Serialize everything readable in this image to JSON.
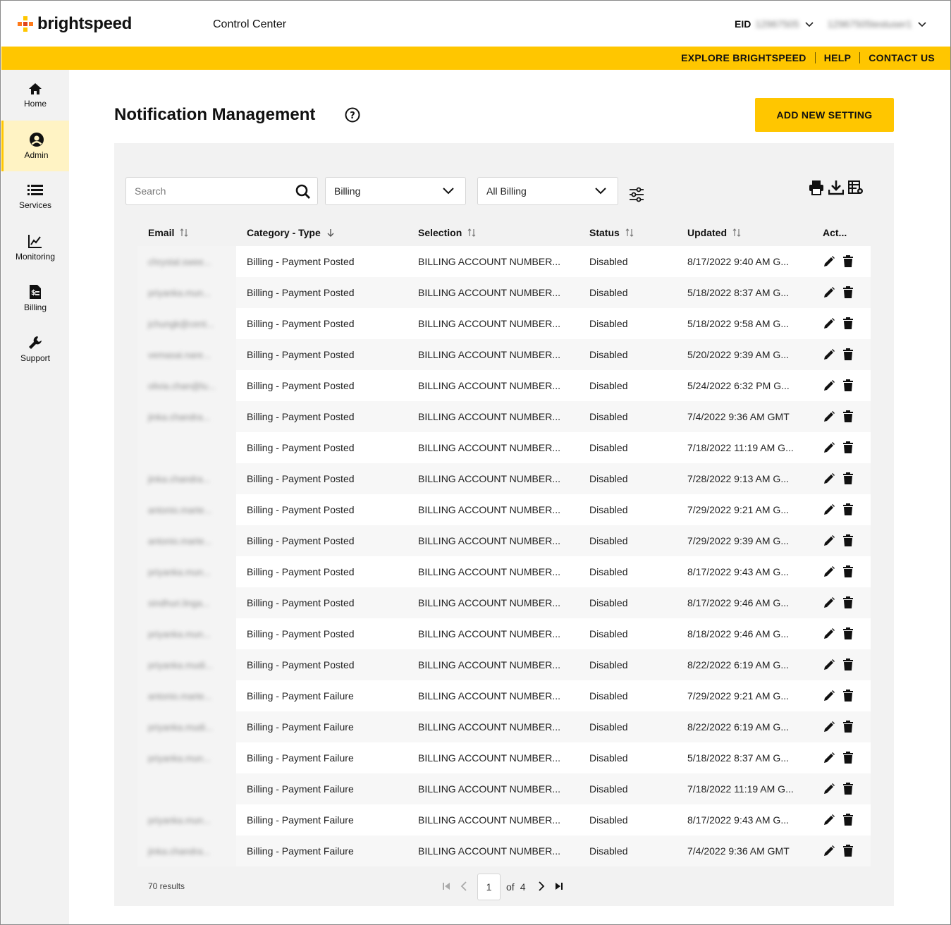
{
  "header": {
    "brand": "brightspeed",
    "app_title": "Control Center",
    "eid_label": "EID",
    "eid_value": "12967505",
    "user": "12967505testuser1"
  },
  "top_links": [
    "EXPLORE BRIGHTSPEED",
    "HELP",
    "CONTACT US"
  ],
  "sidebar": {
    "items": [
      {
        "label": "Home",
        "icon": "home-icon"
      },
      {
        "label": "Admin",
        "icon": "user-circle-icon",
        "active": true
      },
      {
        "label": "Services",
        "icon": "list-icon"
      },
      {
        "label": "Monitoring",
        "icon": "chart-line-icon"
      },
      {
        "label": "Billing",
        "icon": "invoice-icon"
      },
      {
        "label": "Support",
        "icon": "wrench-icon"
      }
    ]
  },
  "page": {
    "title": "Notification Management",
    "add_button": "ADD NEW SETTING"
  },
  "filters": {
    "search_placeholder": "Search",
    "category": "Billing",
    "type": "All Billing"
  },
  "columns": [
    "Email",
    "Category - Type",
    "Selection",
    "Status",
    "Updated",
    "Act..."
  ],
  "rows": [
    {
      "email": "chrystal.swee...",
      "cat": "Billing - Payment Posted",
      "sel": "BILLING ACCOUNT NUMBER...",
      "status": "Disabled",
      "updated": "8/17/2022 9:40 AM G..."
    },
    {
      "email": "priyanka.mun...",
      "cat": "Billing - Payment Posted",
      "sel": "BILLING ACCOUNT NUMBER...",
      "status": "Disabled",
      "updated": "5/18/2022 8:37 AM G..."
    },
    {
      "email": "jchungk@cent...",
      "cat": "Billing - Payment Posted",
      "sel": "BILLING ACCOUNT NUMBER...",
      "status": "Disabled",
      "updated": "5/18/2022 9:58 AM G..."
    },
    {
      "email": "vemasai.nare...",
      "cat": "Billing - Payment Posted",
      "sel": "BILLING ACCOUNT NUMBER...",
      "status": "Disabled",
      "updated": "5/20/2022 9:39 AM G..."
    },
    {
      "email": "olivia.chan@lu...",
      "cat": "Billing - Payment Posted",
      "sel": "BILLING ACCOUNT NUMBER...",
      "status": "Disabled",
      "updated": "5/24/2022 6:32 PM G..."
    },
    {
      "email": "jinka.chandra...",
      "cat": "Billing - Payment Posted",
      "sel": "BILLING ACCOUNT NUMBER...",
      "status": "Disabled",
      "updated": "7/4/2022 9:36 AM GMT"
    },
    {
      "email": "",
      "cat": "Billing - Payment Posted",
      "sel": "BILLING ACCOUNT NUMBER...",
      "status": "Disabled",
      "updated": "7/18/2022 11:19 AM G..."
    },
    {
      "email": "jinka.chandra...",
      "cat": "Billing - Payment Posted",
      "sel": "BILLING ACCOUNT NUMBER...",
      "status": "Disabled",
      "updated": "7/28/2022 9:13 AM G..."
    },
    {
      "email": "antonio.marte...",
      "cat": "Billing - Payment Posted",
      "sel": "BILLING ACCOUNT NUMBER...",
      "status": "Disabled",
      "updated": "7/29/2022 9:21 AM G..."
    },
    {
      "email": "antonio.marte...",
      "cat": "Billing - Payment Posted",
      "sel": "BILLING ACCOUNT NUMBER...",
      "status": "Disabled",
      "updated": "7/29/2022 9:39 AM G..."
    },
    {
      "email": "priyanka.mun...",
      "cat": "Billing - Payment Posted",
      "sel": "BILLING ACCOUNT NUMBER...",
      "status": "Disabled",
      "updated": "8/17/2022 9:43 AM G..."
    },
    {
      "email": "sindhuri.linga...",
      "cat": "Billing - Payment Posted",
      "sel": "BILLING ACCOUNT NUMBER...",
      "status": "Disabled",
      "updated": "8/17/2022 9:46 AM G..."
    },
    {
      "email": "priyanka.mun...",
      "cat": "Billing - Payment Posted",
      "sel": "BILLING ACCOUNT NUMBER...",
      "status": "Disabled",
      "updated": "8/18/2022 9:46 AM G..."
    },
    {
      "email": "priyanka.mudi...",
      "cat": "Billing - Payment Posted",
      "sel": "BILLING ACCOUNT NUMBER...",
      "status": "Disabled",
      "updated": "8/22/2022 6:19 AM G..."
    },
    {
      "email": "antonio.marte...",
      "cat": "Billing - Payment Failure",
      "sel": "BILLING ACCOUNT NUMBER...",
      "status": "Disabled",
      "updated": "7/29/2022 9:21 AM G..."
    },
    {
      "email": "priyanka.mudi...",
      "cat": "Billing - Payment Failure",
      "sel": "BILLING ACCOUNT NUMBER...",
      "status": "Disabled",
      "updated": "8/22/2022 6:19 AM G..."
    },
    {
      "email": "priyanka.mun...",
      "cat": "Billing - Payment Failure",
      "sel": "BILLING ACCOUNT NUMBER...",
      "status": "Disabled",
      "updated": "5/18/2022 8:37 AM G..."
    },
    {
      "email": "",
      "cat": "Billing - Payment Failure",
      "sel": "BILLING ACCOUNT NUMBER...",
      "status": "Disabled",
      "updated": "7/18/2022 11:19 AM G..."
    },
    {
      "email": "priyanka.mun...",
      "cat": "Billing - Payment Failure",
      "sel": "BILLING ACCOUNT NUMBER...",
      "status": "Disabled",
      "updated": "8/17/2022 9:43 AM G..."
    },
    {
      "email": "jinka.chandra...",
      "cat": "Billing - Payment Failure",
      "sel": "BILLING ACCOUNT NUMBER...",
      "status": "Disabled",
      "updated": "7/4/2022 9:36 AM GMT"
    }
  ],
  "pagination": {
    "results": "70 results",
    "current_page": "1",
    "of_label": "of",
    "total_pages": "4"
  },
  "colors": {
    "accent": "#ffc600",
    "sidebar_bg": "#f2f2f2",
    "panel_bg": "#f2f2f2"
  }
}
